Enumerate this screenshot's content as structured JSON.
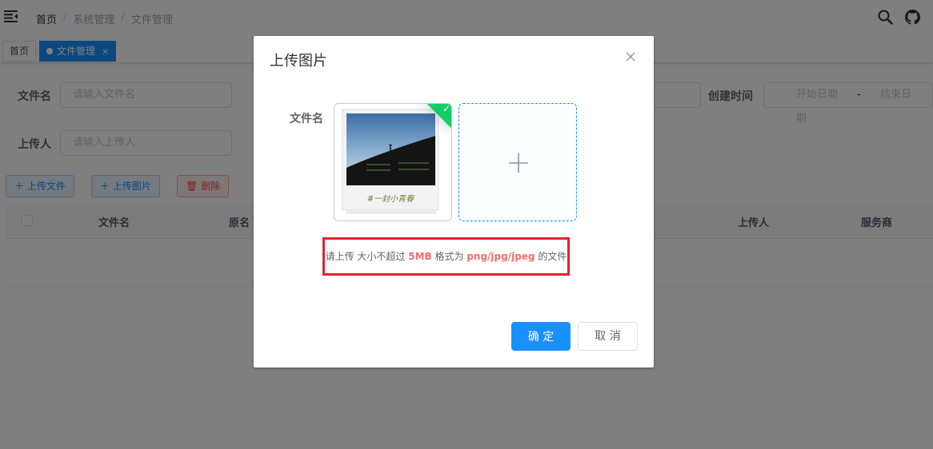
{
  "navbar": {
    "breadcrumb": [
      "首页",
      "系统管理",
      "文件管理"
    ],
    "separator": "/"
  },
  "tags": {
    "home": "首页",
    "active": "文件管理",
    "close": "×"
  },
  "search_form": {
    "file_name_label": "文件名",
    "file_name_placeholder": "请输入文件名",
    "uploader_label": "上传人",
    "uploader_placeholder": "请输入上传人",
    "create_time_label": "创建时间",
    "start_date_placeholder": "开始日期",
    "date_separator": "-",
    "end_date_placeholder": "结束日期"
  },
  "toolbar": {
    "upload_file": "上传文件",
    "upload_image": "上传图片",
    "delete": "删除"
  },
  "table": {
    "columns": [
      "文件名",
      "原名",
      "上传人",
      "服务商"
    ]
  },
  "dialog": {
    "title": "上传图片",
    "field_label": "文件名",
    "tip_prefix": "请上传 大小不超过 ",
    "tip_size": "5MB",
    "tip_middle": " 格式为 ",
    "tip_formats": "png/jpg/jpeg",
    "tip_suffix": " 的文件",
    "confirm": "确 定",
    "cancel": "取 消"
  },
  "colors": {
    "primary": "#1890ff",
    "success": "#13ce66",
    "danger": "#f56c6c",
    "highlight_border": "#e3222b"
  }
}
